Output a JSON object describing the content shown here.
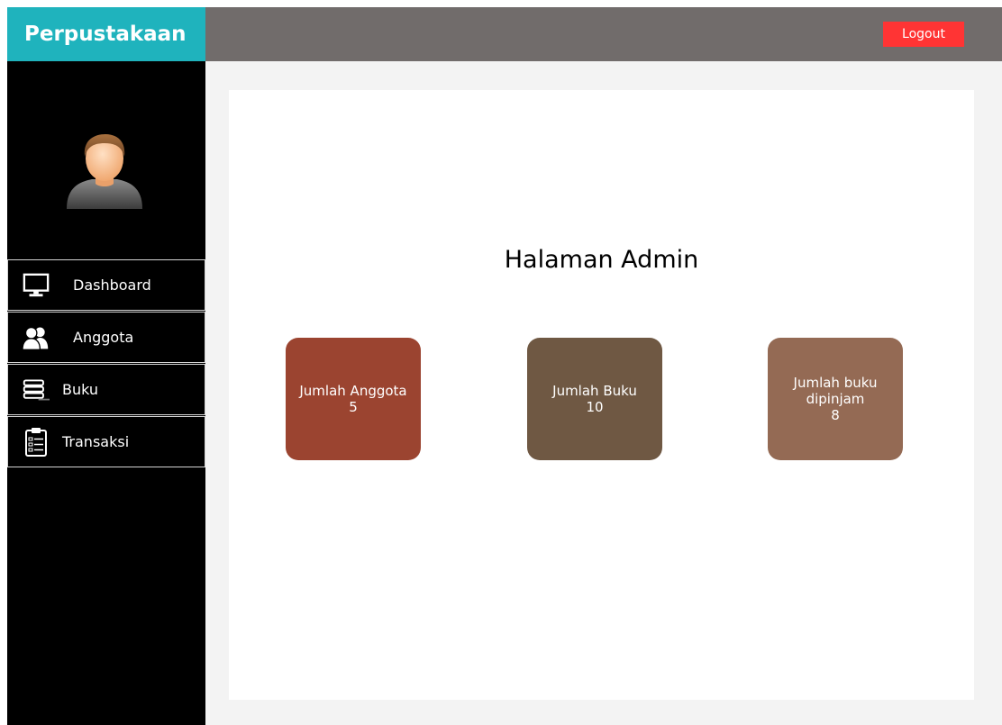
{
  "app": {
    "title": "Perpustakaan"
  },
  "header": {
    "logout_label": "Logout"
  },
  "sidebar": {
    "items": [
      {
        "label": "Dashboard",
        "icon": "monitor-icon"
      },
      {
        "label": "Anggota",
        "icon": "users-icon"
      },
      {
        "label": "Buku",
        "icon": "books-icon"
      },
      {
        "label": "Transaksi",
        "icon": "clipboard-list-icon"
      }
    ]
  },
  "main": {
    "title": "Halaman Admin",
    "cards": [
      {
        "label": "Jumlah Anggota",
        "value": "5",
        "color": "#9b4430"
      },
      {
        "label": "Jumlah Buku",
        "value": "10",
        "color": "#6f5843"
      },
      {
        "label": "Jumlah buku dipinjam",
        "value": "8",
        "color": "#946a54"
      }
    ]
  },
  "colors": {
    "brand": "#1fb3bd",
    "topbar": "#716c6b",
    "logout": "#ff3434",
    "sidebar": "#000000",
    "content_bg": "#f3f3f3"
  }
}
